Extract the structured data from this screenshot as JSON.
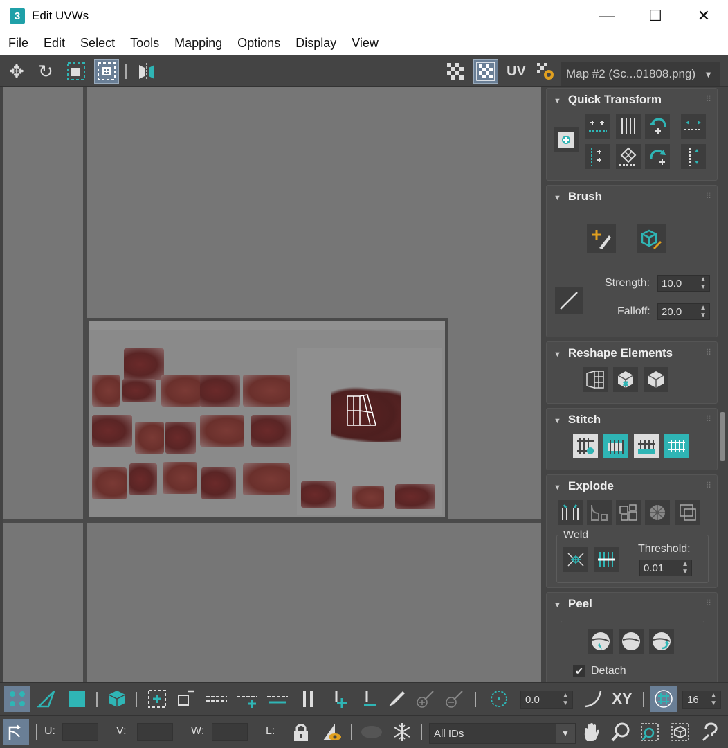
{
  "window": {
    "app_badge": "3",
    "title": "Edit UVWs",
    "minimize": "—",
    "maximize": "☐",
    "close": "✕"
  },
  "menu": [
    "File",
    "Edit",
    "Select",
    "Tools",
    "Mapping",
    "Options",
    "Display",
    "View"
  ],
  "toolbar": {
    "uv_label": "UV",
    "map_select": "Map #2 (Sc...01808.png)",
    "map_arrow": "▼"
  },
  "panels": {
    "quick_transform": {
      "title": "Quick Transform"
    },
    "brush": {
      "title": "Brush",
      "strength_label": "Strength:",
      "strength_value": "10.0",
      "falloff_label": "Falloff:",
      "falloff_value": "20.0"
    },
    "reshape": {
      "title": "Reshape Elements"
    },
    "stitch": {
      "title": "Stitch"
    },
    "explode": {
      "title": "Explode",
      "weld_label": "Weld",
      "threshold_label": "Threshold:",
      "threshold_value": "0.01"
    },
    "peel": {
      "title": "Peel",
      "detach_label": "Detach",
      "detach_checked": true
    }
  },
  "bottom": {
    "angle_value": "0.0",
    "xy_label": "XY",
    "grid_value": "16",
    "u_label": "U:",
    "v_label": "V:",
    "w_label": "W:",
    "l_label": "L:",
    "id_select": "All IDs",
    "id_arrow": "▼"
  },
  "colors": {
    "accent_teal": "#2fb5b5",
    "active_blue": "#6a7f96",
    "panel_bg": "#444444",
    "viewport_bg": "#767676"
  }
}
